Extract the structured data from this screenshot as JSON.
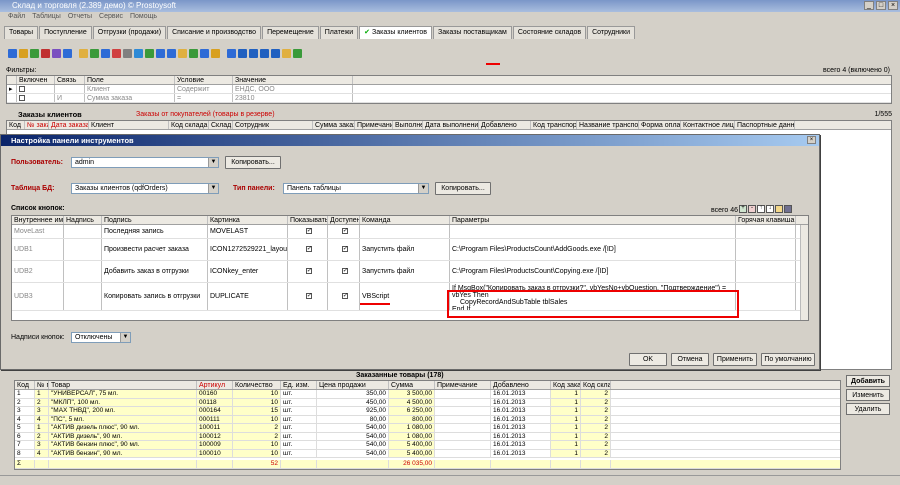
{
  "window": {
    "title": "Склад и торговля (2.389 демо) © Prostoysoft"
  },
  "menu": [
    "Файл",
    "Таблицы",
    "Отчеты",
    "Сервис",
    "Помощь"
  ],
  "tabs": [
    "Товары",
    "Поступление",
    "Отгрузки (продажи)",
    "Списание и производство",
    "Перемещение",
    "Платежи",
    "Заказы клиентов",
    "Заказы поставщикам",
    "Состояние складов",
    "Сотрудники"
  ],
  "active_tab": "Заказы клиентов",
  "filters": {
    "label": "Фильтры:",
    "count": "всего 4 (включено 0)",
    "headers": [
      "Включен",
      "Связь",
      "Поле",
      "Условие",
      "Значение"
    ],
    "rows": [
      {
        "link": "",
        "field": "Клиент",
        "cond": "Содержит",
        "value": "ЕНДС, ООО"
      },
      {
        "link": "И",
        "field": "Сумма заказа",
        "cond": "=",
        "value": "23810"
      }
    ]
  },
  "orders": {
    "title": "Заказы клиентов",
    "subtitle": "Заказы от покупателей (товары в резерве)",
    "count": "1/555",
    "headers": [
      "Код",
      "№ заказа",
      "Дата заказа",
      "Клиент",
      "Код склада",
      "Склад",
      "Сотрудник",
      "Сумма заказа",
      "Примечание",
      "Выполнен",
      "Дата выполнения",
      "Добавлено",
      "Код транспортной",
      "Название транспортной",
      "Форма оплаты",
      "Контактное лицо",
      "Паспортные данные"
    ]
  },
  "dialog": {
    "title": "Настройка панели инструментов",
    "user_label": "Пользователь:",
    "user_value": "admin",
    "copy_button": "Копировать...",
    "table_label": "Таблица БД:",
    "table_value": "Заказы клиентов (qdfOrders)",
    "panel_type_label": "Тип панели:",
    "panel_type_value": "Панель таблицы",
    "copy_button2": "Копировать...",
    "buttons_list_label": "Список кнопок:",
    "total": "всего 46",
    "headers": [
      "Внутреннее имя",
      "Надпись",
      "Подпись",
      "Картинка",
      "Показывать",
      "Доступен",
      "Команда",
      "Параметры",
      "Горячая клавиша"
    ],
    "rows": [
      {
        "name": "MoveLast",
        "caption": "",
        "hint": "Последняя запись",
        "image": "MOVELAST",
        "show": true,
        "enabled": true,
        "command": "",
        "params": ""
      },
      {
        "name": "UDB1",
        "caption": "",
        "hint": "Произвести расчет заказа",
        "image": "ICON1272529221_layou",
        "show": true,
        "enabled": true,
        "command": "Запустить файл",
        "params": "C:\\Program Files\\ProductsCount\\AddGoods.exe /[ID]"
      },
      {
        "name": "UDB2",
        "caption": "",
        "hint": "Добавить заказ в отгрузки",
        "image": "ICONkey_enter",
        "show": true,
        "enabled": true,
        "command": "Запустить файл",
        "params": "C:\\Program Files\\ProductsCount\\Copying.exe /[ID]"
      },
      {
        "name": "UDB3",
        "caption": "",
        "hint": "Копировать запись в отгрузки",
        "image": "DUPLICATE",
        "show": true,
        "enabled": true,
        "command": "VBScript",
        "params_lines": [
          "If MsgBox(\"Копировать заказ в отгрузки?\", vbYesNo+vbQuestion, \"Подтверждение\") = vbYes Then",
          "CopyRecordAndSubTable tblSales",
          "End If"
        ]
      }
    ],
    "captions_label": "Надписи кнопок:",
    "captions_value": "Отключены",
    "ok": "OK",
    "cancel": "Отмена",
    "apply": "Применить",
    "defaults": "По умолчанию"
  },
  "goods": {
    "title": "Заказанные товары (178)",
    "headers": [
      "Код",
      "№ пп",
      "Товар",
      "Артикул",
      "Количество",
      "Ед. изм.",
      "Цена продажи",
      "Сумма",
      "Примечание",
      "Добавлено",
      "Код заказа",
      "Код склада"
    ],
    "rows": [
      [
        "1",
        "1",
        "\"УНИВЕРСАЛ\", 75 мл.",
        "00160",
        "10",
        "шт.",
        "350,00",
        "3 500,00",
        "",
        "16.01.2013",
        "1",
        "2"
      ],
      [
        "2",
        "2",
        "\"МКЛП\", 100 мл.",
        "00118",
        "10",
        "шт.",
        "450,00",
        "4 500,00",
        "",
        "16.01.2013",
        "1",
        "2"
      ],
      [
        "3",
        "3",
        "\"МАХ ТНВД\", 200 мл.",
        "000164",
        "15",
        "шт.",
        "925,00",
        "6 250,00",
        "",
        "16.01.2013",
        "1",
        "2"
      ],
      [
        "4",
        "4",
        "\"ПС\", 5 мл.",
        "000111",
        "10",
        "шт.",
        "80,00",
        "800,00",
        "",
        "16.01.2013",
        "1",
        "2"
      ],
      [
        "5",
        "1",
        "\"АКТИВ дизель плюс\", 90 мл.",
        "100011",
        "2",
        "шт.",
        "540,00",
        "1 080,00",
        "",
        "16.01.2013",
        "1",
        "2"
      ],
      [
        "6",
        "2",
        "\"АКТИВ дизель\", 90 мл.",
        "100012",
        "2",
        "шт.",
        "540,00",
        "1 080,00",
        "",
        "16.01.2013",
        "1",
        "2"
      ],
      [
        "7",
        "3",
        "\"АКТИВ бензин плюс\", 90 мл.",
        "100009",
        "10",
        "шт.",
        "540,00",
        "5 400,00",
        "",
        "16.01.2013",
        "1",
        "2"
      ],
      [
        "8",
        "4",
        "\"АКТИВ бензин\", 90 мл.",
        "100010",
        "10",
        "шт.",
        "540,00",
        "5 400,00",
        "",
        "16.01.2013",
        "1",
        "2"
      ]
    ],
    "total_qty": "52",
    "total_sum": "26 035,00"
  },
  "side_buttons": [
    "Добавить",
    "Изменить",
    "Удалить"
  ],
  "colors": {
    "accent_red": "#e00000",
    "title_blue": "#0a246a",
    "highlight_yellow": "#ffffc8"
  }
}
